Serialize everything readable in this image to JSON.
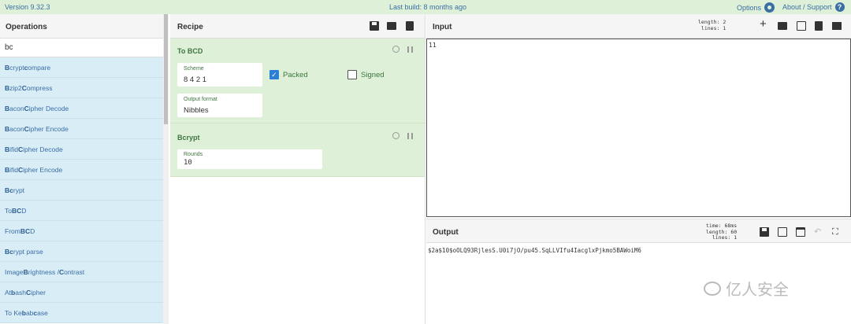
{
  "topbar": {
    "version": "Version 9.32.3",
    "build": "Last build: 8 months ago",
    "options": "Options",
    "about": "About / Support",
    "help_glyph": "?"
  },
  "operations": {
    "title": "Operations",
    "search_value": "bc",
    "items": [
      {
        "pre": "",
        "b1": "B",
        "mid": "crypt ",
        "b2": "c",
        "post": "ompare"
      },
      {
        "pre": "",
        "b1": "B",
        "mid": "zip2 ",
        "b2": "C",
        "post": "ompress"
      },
      {
        "pre": "",
        "b1": "B",
        "mid": "acon ",
        "b2": "C",
        "post": "ipher Decode"
      },
      {
        "pre": "",
        "b1": "B",
        "mid": "acon ",
        "b2": "C",
        "post": "ipher Encode"
      },
      {
        "pre": "",
        "b1": "B",
        "mid": "ifid ",
        "b2": "C",
        "post": "ipher Decode"
      },
      {
        "pre": "",
        "b1": "B",
        "mid": "ifid ",
        "b2": "C",
        "post": "ipher Encode"
      },
      {
        "pre": "",
        "b1": "Bc",
        "mid": "rypt",
        "b2": "",
        "post": ""
      },
      {
        "pre": "To ",
        "b1": "BC",
        "mid": "D",
        "b2": "",
        "post": ""
      },
      {
        "pre": "From ",
        "b1": "BC",
        "mid": "D",
        "b2": "",
        "post": ""
      },
      {
        "pre": "",
        "b1": "Bc",
        "mid": "rypt parse",
        "b2": "",
        "post": ""
      },
      {
        "pre": "Image ",
        "b1": "B",
        "mid": "rightness / ",
        "b2": "C",
        "post": "ontrast"
      },
      {
        "pre": "At",
        "b1": "b",
        "mid": "ash ",
        "b2": "C",
        "post": "ipher"
      },
      {
        "pre": "To Ke",
        "b1": "b",
        "mid": "ab ",
        "b2": "c",
        "post": "ase"
      }
    ]
  },
  "recipe": {
    "title": "Recipe",
    "to_bcd": {
      "title": "To BCD",
      "scheme_label": "Scheme",
      "scheme_value": "8 4 2 1",
      "packed_label": "Packed",
      "packed_checked": true,
      "signed_label": "Signed",
      "signed_checked": false,
      "output_format_label": "Output format",
      "output_format_value": "Nibbles"
    },
    "bcrypt": {
      "title": "Bcrypt",
      "rounds_label": "Rounds",
      "rounds_value": "10"
    }
  },
  "input": {
    "title": "Input",
    "length_label": "length:",
    "length_value": "2",
    "lines_label": "lines:",
    "lines_value": "1",
    "value": "11"
  },
  "output": {
    "title": "Output",
    "time_label": "time:",
    "time_value": "68ms",
    "length_label": "length:",
    "length_value": "60",
    "lines_label": "lines:",
    "lines_value": "1",
    "value": "$2a$10$oOLQ93RjlesS.U0i7jO/pu45.SqLLVIfu4IacglxPjkmo5BAWoiM6"
  },
  "watermark": {
    "text": "亿人安全"
  }
}
